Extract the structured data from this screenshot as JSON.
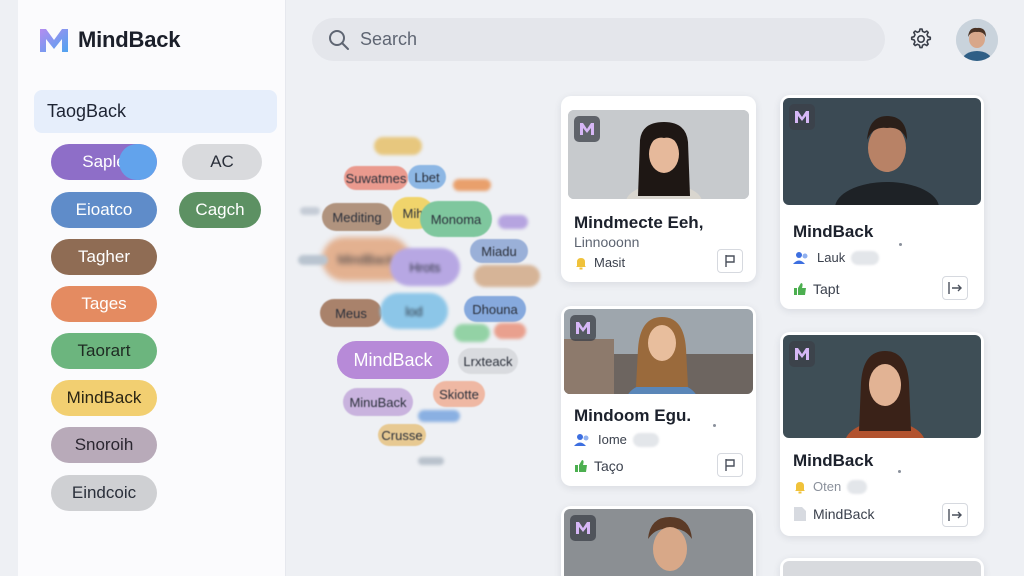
{
  "app": {
    "name": "MindBack"
  },
  "sidebar": {
    "active_item": "TaogBack",
    "tags": [
      {
        "label": "Saple",
        "color": "#8e6ec8"
      },
      {
        "label": "AC",
        "color": "#d9dadd"
      },
      {
        "label": "Eioatco",
        "color": "#5f8cc9"
      },
      {
        "label": "Cagch",
        "color": "#5d9163"
      },
      {
        "label": "Tagher",
        "color": "#8f6c54"
      },
      {
        "label": "Tages",
        "color": "#e48b61"
      },
      {
        "label": "Taorart",
        "color": "#6cb57e"
      },
      {
        "label": "MindBack",
        "color": "#f2cf71"
      },
      {
        "label": "Snoroih",
        "color": "#b8aab9"
      },
      {
        "label": "Eindcoic",
        "color": "#cfd0d3"
      }
    ]
  },
  "search": {
    "placeholder": "Search"
  },
  "cloud": {
    "tags": [
      "Suwatmes",
      "Lbet",
      "Mediting",
      "Mih",
      "Monoma",
      "MindBack",
      "Hrots",
      "Miadu",
      "Meus",
      "lod",
      "Dhouna",
      "MindBack",
      "Lrxteack",
      "MinuBack",
      "Skiotte",
      "Crusse"
    ]
  },
  "cards": [
    {
      "title": "Mindmecte Eeh,",
      "subtitle": "Linnooonn",
      "meta": "Masit"
    },
    {
      "title": "MindBack",
      "meta1": "Lauk",
      "meta2": "Tapt"
    },
    {
      "title": "Mindoom Egu.",
      "meta1": "Iome",
      "meta2": "Taço"
    },
    {
      "title": "MindBack",
      "meta1": "Oten",
      "meta2": "MindBack"
    }
  ]
}
